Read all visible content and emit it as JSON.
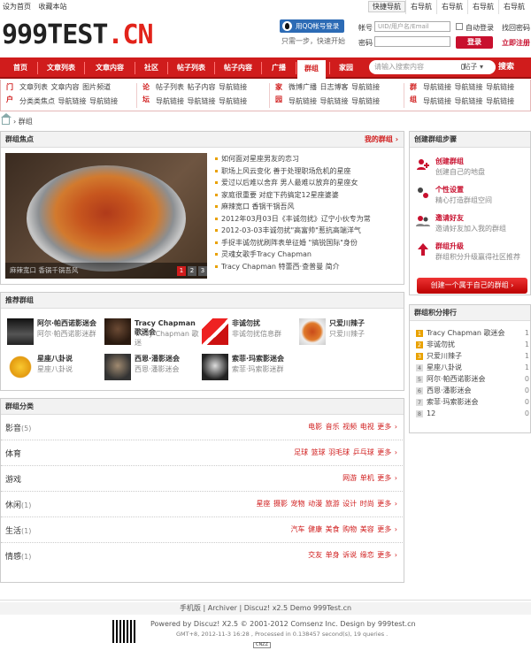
{
  "topbar": {
    "left": [
      "设为首页",
      "收藏本站"
    ],
    "quick_nav": "快捷导航",
    "right": [
      "右导航",
      "右导航",
      "右导航",
      "右导航"
    ]
  },
  "logo": {
    "main": "999TEST",
    "suffix": ".CN"
  },
  "qq": {
    "label": "用QQ帐号登录",
    "note": "只需一步，快速开始"
  },
  "login": {
    "account_label": "帐号",
    "account_placeholder": "UID/用户名/Email",
    "auto_login": "自动登录",
    "forgot": "找回密码",
    "password_label": "密码",
    "login_button": "登录",
    "register": "立即注册"
  },
  "nav": {
    "items": [
      "首页",
      "文章列表",
      "文章内容",
      "社区",
      "帖子列表",
      "帖子内容",
      "广播",
      "群组",
      "家园"
    ],
    "active": "群组",
    "search_placeholder": "请输入搜索内容",
    "search_type": "帖子",
    "search_button": "搜索"
  },
  "subnav": {
    "groups": [
      {
        "title": "门户",
        "line1": "文章列表  文章内容  图片频道",
        "line2": "分类类焦点  导航链接  导航链接"
      },
      {
        "title": "论坛",
        "line1": "帖子列表  帖子内容  导航链接",
        "line2": "导航链接  导航链接  导航链接"
      },
      {
        "title": "家园",
        "line1": "微博广播  日志博客  导航链接",
        "line2": "导航链接  导航链接  导航链接"
      },
      {
        "title": "群组",
        "line1": "导航链接  导航链接  导航链接",
        "line2": "导航链接  导航链接  导航链接"
      }
    ]
  },
  "breadcrumb": {
    "current": "群组"
  },
  "focus": {
    "title": "群组焦点",
    "my_groups": "我的群组",
    "caption": "麻辣宽口  香锅千锅吾风",
    "pages": [
      "1",
      "2",
      "3"
    ],
    "items": [
      "如何面对星座男友的恋习",
      "职场上风云变化 善于处理职场危机的星座",
      "爱过以后难以舍弃 男人最难以放弃的星座女",
      "家庭很重要 对症下药搞定12星座婆婆",
      "麻辣宽口 香锅干锅吾风",
      "2012年03月03日《丰诚勿扰》辽宁小伙专为常",
      "2012-03-03丰诚勿扰\"高富帅\"惹抗高端洋气",
      "手捉丰诚勿扰刷阵表单征婚 \"搞锐国际\"身份",
      "灵魂女歌手Tracy Chapman",
      "Tracy Chapman 特蕾西·查普曼 简介"
    ]
  },
  "recommended": {
    "title": "推荐群组",
    "items": [
      {
        "name": "阿尔·帕西诺影迷会",
        "desc": "阿尔·帕西诺影迷群"
      },
      {
        "name": "Tracy Chapman 歌迷会",
        "desc": "Tracy Chapman 歌迷"
      },
      {
        "name": "非诚勿扰",
        "desc": "非诚勿扰信息群"
      },
      {
        "name": "只爱川辣子",
        "desc": "只爱川辣子"
      },
      {
        "name": "星座八卦说",
        "desc": "星座八卦说"
      },
      {
        "name": "西恩·潘影迷会",
        "desc": "西恩·潘影迷会"
      },
      {
        "name": "索菲·玛索影迷会",
        "desc": "索菲·玛索影迷群"
      }
    ]
  },
  "categories": {
    "title": "群组分类",
    "rows": [
      {
        "name": "影音",
        "count": "(5)",
        "tags": "电影 音乐 视频 电视 更多 ›"
      },
      {
        "name": "体育",
        "count": "",
        "tags": "足球 篮球 羽毛球 乒乓球 更多 ›"
      },
      {
        "name": "游戏",
        "count": "",
        "tags": "网游 单机 更多 ›"
      },
      {
        "name": "休闲",
        "count": "(1)",
        "tags": "星座 摄影 宠物 动漫 旅游 设计 时尚 更多 ›"
      },
      {
        "name": "生活",
        "count": "(1)",
        "tags": "汽车 健康 美食 购物 美容 更多 ›"
      },
      {
        "name": "情感",
        "count": "(1)",
        "tags": "交友 单身 诉说 缘恋 更多 ›"
      }
    ]
  },
  "steps": {
    "title": "创建群组步骤",
    "items": [
      {
        "title": "创建群组",
        "desc": "创建自己的地盘"
      },
      {
        "title": "个性设置",
        "desc": "精心打造群组空间"
      },
      {
        "title": "邀请好友",
        "desc": "邀请好友加入我的群组"
      },
      {
        "title": "群组升级",
        "desc": "群组积分升级赢得社区推荐"
      }
    ],
    "button": "创建一个属于自己的群组 ›"
  },
  "ranking": {
    "title": "群组积分排行",
    "items": [
      {
        "rank": "1",
        "name": "Tracy Chapman 歌迷会",
        "score": "1"
      },
      {
        "rank": "2",
        "name": "非诚勿扰",
        "score": "1"
      },
      {
        "rank": "3",
        "name": "只爱川辣子",
        "score": "1"
      },
      {
        "rank": "4",
        "name": "星座八卦说",
        "score": "1"
      },
      {
        "rank": "5",
        "name": "阿尔·帕西诺影迷会",
        "score": "0"
      },
      {
        "rank": "6",
        "name": "西恩·潘影迷会",
        "score": "0"
      },
      {
        "rank": "7",
        "name": "索菲·玛索影迷会",
        "score": "0"
      },
      {
        "rank": "8",
        "name": "12",
        "score": "0"
      }
    ]
  },
  "footer": {
    "links": "手机版  |  Archiver  |  Discuz! x2.5 Demo 999Test.cn",
    "powered": "Powered by Discuz! X2.5 © 2001-2012 Comsenz Inc. Design by 999test.cn",
    "stats": "GMT+8, 2012-11-3 16:28 , Processed in 0.138457 second(s), 19 queries .",
    "cnzz": "CNZZ"
  }
}
